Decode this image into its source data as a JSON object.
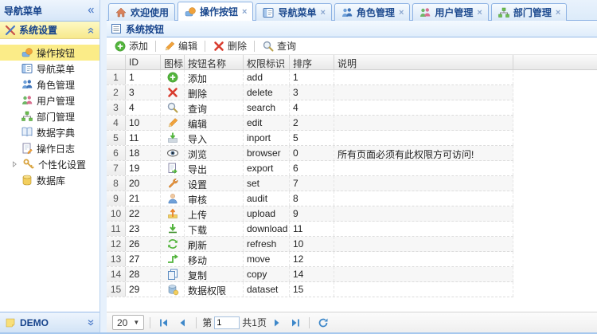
{
  "colors": {
    "accent_navy": "#15428b",
    "selected_item_bg": "#fbec88",
    "tab_border": "#8db2e3",
    "pager_icon_blue": "#3d87c9",
    "section_yellow": "#f7e98c"
  },
  "sidebar": {
    "title": "导航菜单",
    "collapse_icon": "chevrons-left-icon",
    "section": {
      "label": "系统设置",
      "icon": "tools-icon",
      "collapse_icon": "chevrons-up-icon"
    },
    "items": [
      {
        "label": "操作按钮",
        "icon": "buttons-icon",
        "selected": true,
        "expandable": false
      },
      {
        "label": "导航菜单",
        "icon": "navmenu-icon",
        "selected": false,
        "expandable": false
      },
      {
        "label": "角色管理",
        "icon": "roles-icon",
        "selected": false,
        "expandable": false
      },
      {
        "label": "用户管理",
        "icon": "users-icon",
        "selected": false,
        "expandable": false
      },
      {
        "label": "部门管理",
        "icon": "dept-icon",
        "selected": false,
        "expandable": false
      },
      {
        "label": "数据字典",
        "icon": "dict-icon",
        "selected": false,
        "expandable": false
      },
      {
        "label": "操作日志",
        "icon": "log-icon",
        "selected": false,
        "expandable": false
      },
      {
        "label": "个性化设置",
        "icon": "personalize-icon",
        "selected": false,
        "expandable": true
      },
      {
        "label": "数据库",
        "icon": "database-icon",
        "selected": false,
        "expandable": false
      }
    ],
    "footer": {
      "label": "DEMO",
      "icon": "note-icon",
      "collapse_icon": "chevrons-down-icon"
    }
  },
  "tabs": [
    {
      "label": "欢迎使用",
      "icon": "home-icon",
      "closable": false,
      "active": false
    },
    {
      "label": "操作按钮",
      "icon": "buttons-icon",
      "closable": true,
      "active": true
    },
    {
      "label": "导航菜单",
      "icon": "navmenu-icon",
      "closable": true,
      "active": false
    },
    {
      "label": "角色管理",
      "icon": "roles-icon",
      "closable": true,
      "active": false
    },
    {
      "label": "用户管理",
      "icon": "users-icon",
      "closable": true,
      "active": false
    },
    {
      "label": "部门管理",
      "icon": "dept-icon",
      "closable": true,
      "active": false
    }
  ],
  "panel": {
    "title": "系统按钮",
    "icon": "list-icon"
  },
  "toolbar": [
    {
      "label": "添加",
      "icon": "add-icon"
    },
    {
      "label": "编辑",
      "icon": "edit-icon"
    },
    {
      "label": "删除",
      "icon": "delete-icon"
    },
    {
      "label": "查询",
      "icon": "search-icon"
    }
  ],
  "grid": {
    "columns": [
      "",
      "ID",
      "图标",
      "按钮名称",
      "权限标识",
      "排序",
      "说明"
    ],
    "rows": [
      {
        "num": "1",
        "id": "1",
        "icon": "add-icon",
        "name": "添加",
        "perm": "add",
        "sort": "1",
        "desc": ""
      },
      {
        "num": "2",
        "id": "3",
        "icon": "delete-icon",
        "name": "删除",
        "perm": "delete",
        "sort": "3",
        "desc": ""
      },
      {
        "num": "3",
        "id": "4",
        "icon": "search-icon",
        "name": "查询",
        "perm": "search",
        "sort": "4",
        "desc": ""
      },
      {
        "num": "4",
        "id": "10",
        "icon": "edit-icon",
        "name": "编辑",
        "perm": "edit",
        "sort": "2",
        "desc": ""
      },
      {
        "num": "5",
        "id": "11",
        "icon": "import-icon",
        "name": "导入",
        "perm": "inport",
        "sort": "5",
        "desc": ""
      },
      {
        "num": "6",
        "id": "18",
        "icon": "eye-icon",
        "name": "浏览",
        "perm": "browser",
        "sort": "0",
        "desc": "所有页面必须有此权限方可访问!"
      },
      {
        "num": "7",
        "id": "19",
        "icon": "export-icon",
        "name": "导出",
        "perm": "export",
        "sort": "6",
        "desc": ""
      },
      {
        "num": "8",
        "id": "20",
        "icon": "wrench-icon",
        "name": "设置",
        "perm": "set",
        "sort": "7",
        "desc": ""
      },
      {
        "num": "9",
        "id": "21",
        "icon": "person-icon",
        "name": "审核",
        "perm": "audit",
        "sort": "8",
        "desc": ""
      },
      {
        "num": "10",
        "id": "22",
        "icon": "upload-icon",
        "name": "上传",
        "perm": "upload",
        "sort": "9",
        "desc": ""
      },
      {
        "num": "11",
        "id": "23",
        "icon": "download-icon",
        "name": "下载",
        "perm": "download",
        "sort": "11",
        "desc": ""
      },
      {
        "num": "12",
        "id": "26",
        "icon": "refresh-icon",
        "name": "刷新",
        "perm": "refresh",
        "sort": "10",
        "desc": ""
      },
      {
        "num": "13",
        "id": "27",
        "icon": "move-icon",
        "name": "移动",
        "perm": "move",
        "sort": "12",
        "desc": ""
      },
      {
        "num": "14",
        "id": "28",
        "icon": "copy-icon",
        "name": "复制",
        "perm": "copy",
        "sort": "14",
        "desc": ""
      },
      {
        "num": "15",
        "id": "29",
        "icon": "dataset-icon",
        "name": "数据权限",
        "perm": "dataset",
        "sort": "15",
        "desc": ""
      }
    ]
  },
  "pager": {
    "page_size": "20",
    "page_prefix": "第",
    "page_value": "1",
    "page_total": "共1页",
    "icons": [
      "first-icon",
      "prev-icon",
      "next-icon",
      "last-icon",
      "reload-icon"
    ]
  }
}
